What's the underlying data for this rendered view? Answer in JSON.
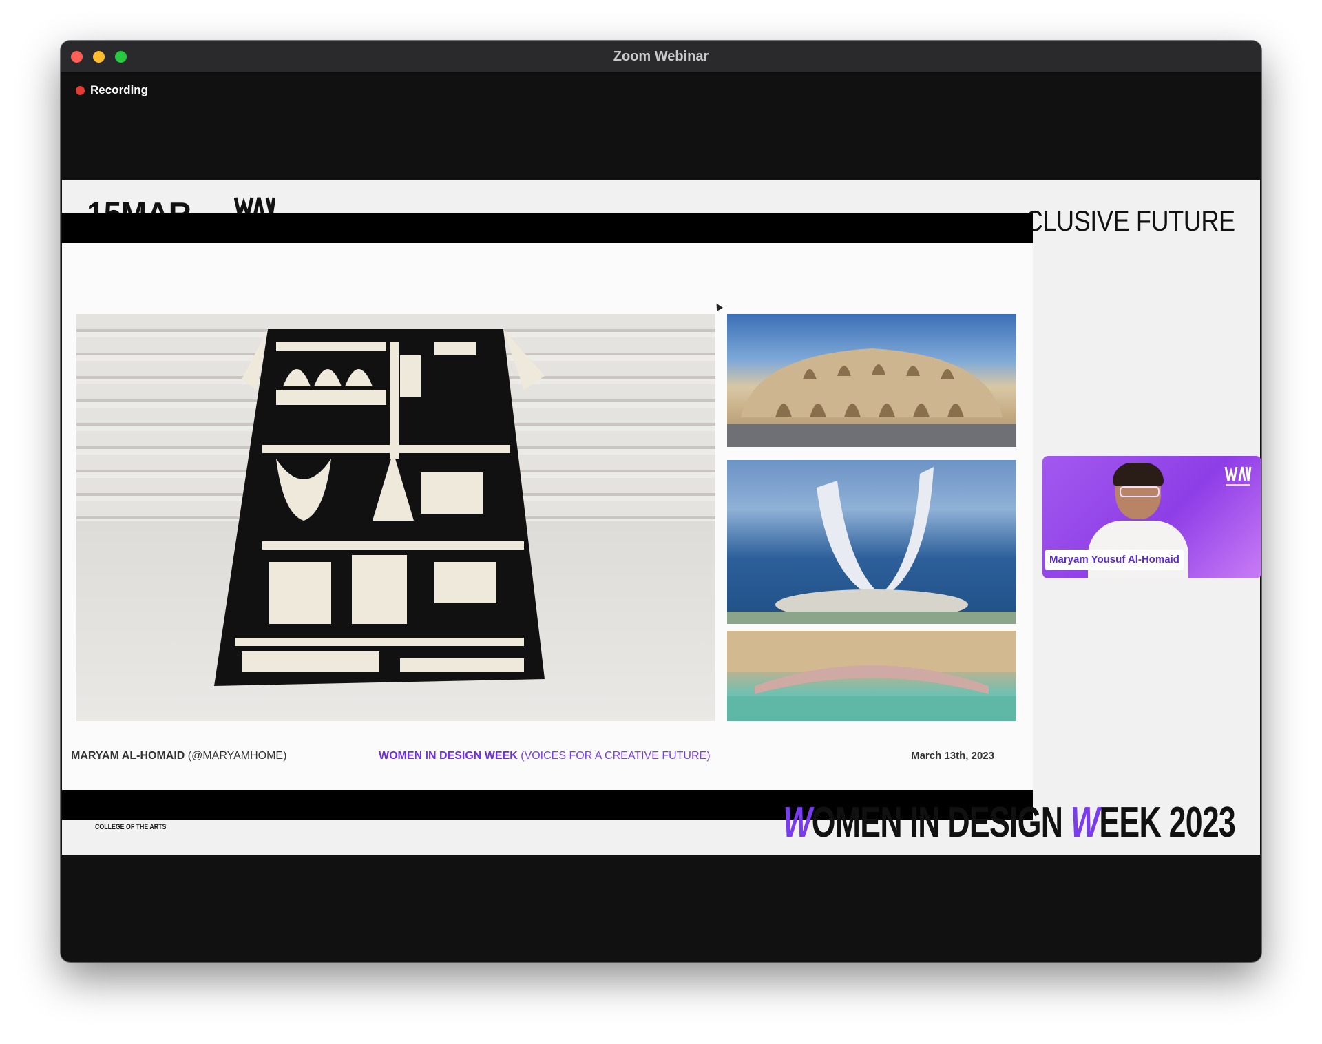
{
  "window": {
    "title": "Zoom Webinar",
    "recording_label": "Recording"
  },
  "slide_header": {
    "date_text": "15MAR",
    "right_text": "CLUSIVE FUTURE"
  },
  "slide": {
    "footer_left_name": "MARYAM AL-HOMAID",
    "footer_left_handle": "(@MARYAMHOME)",
    "footer_mid_title": "WOMEN IN DESIGN WEEK",
    "footer_mid_sub": "(VOICES FOR A CREATIVE FUTURE)",
    "footer_date": "March 13th, 2023"
  },
  "slide_footer": {
    "college": "COLLEGE OF THE ARTS",
    "wdw_w1": "W",
    "wdw_part1": "OMEN IN DESIGN ",
    "wdw_w2": "W",
    "wdw_part2": "EEK 2023"
  },
  "speaker": {
    "name": "Maryam Yousuf Al-Homaid"
  },
  "colors": {
    "accent": "#7a3cf0",
    "record": "#e53b30",
    "tile": "#a259ef"
  }
}
